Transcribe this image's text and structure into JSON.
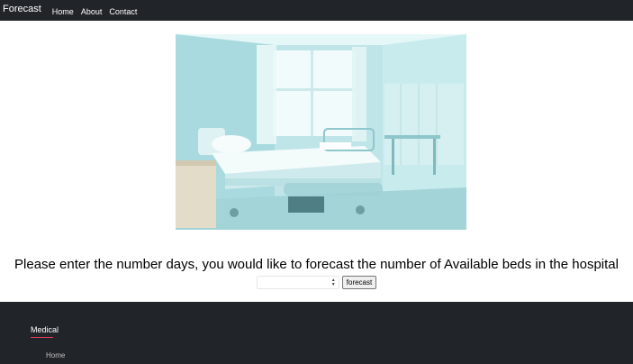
{
  "navbar": {
    "brand": "Forecast",
    "links": [
      "Home",
      "About",
      "Contact"
    ]
  },
  "hero": {
    "image_icon": "hospital-room-photo"
  },
  "main": {
    "prompt": "Please enter the number days, you would like to forecast the number of Available beds in the hospital",
    "days_input": {
      "value": "",
      "placeholder": ""
    },
    "forecast_button": "forecast"
  },
  "footer": {
    "heading": "Medical",
    "links": [
      "Home"
    ],
    "accent_color": "#e83e5c"
  },
  "colors": {
    "navbar_bg": "#212529",
    "footer_bg": "#212529",
    "page_bg": "#ffffff"
  }
}
